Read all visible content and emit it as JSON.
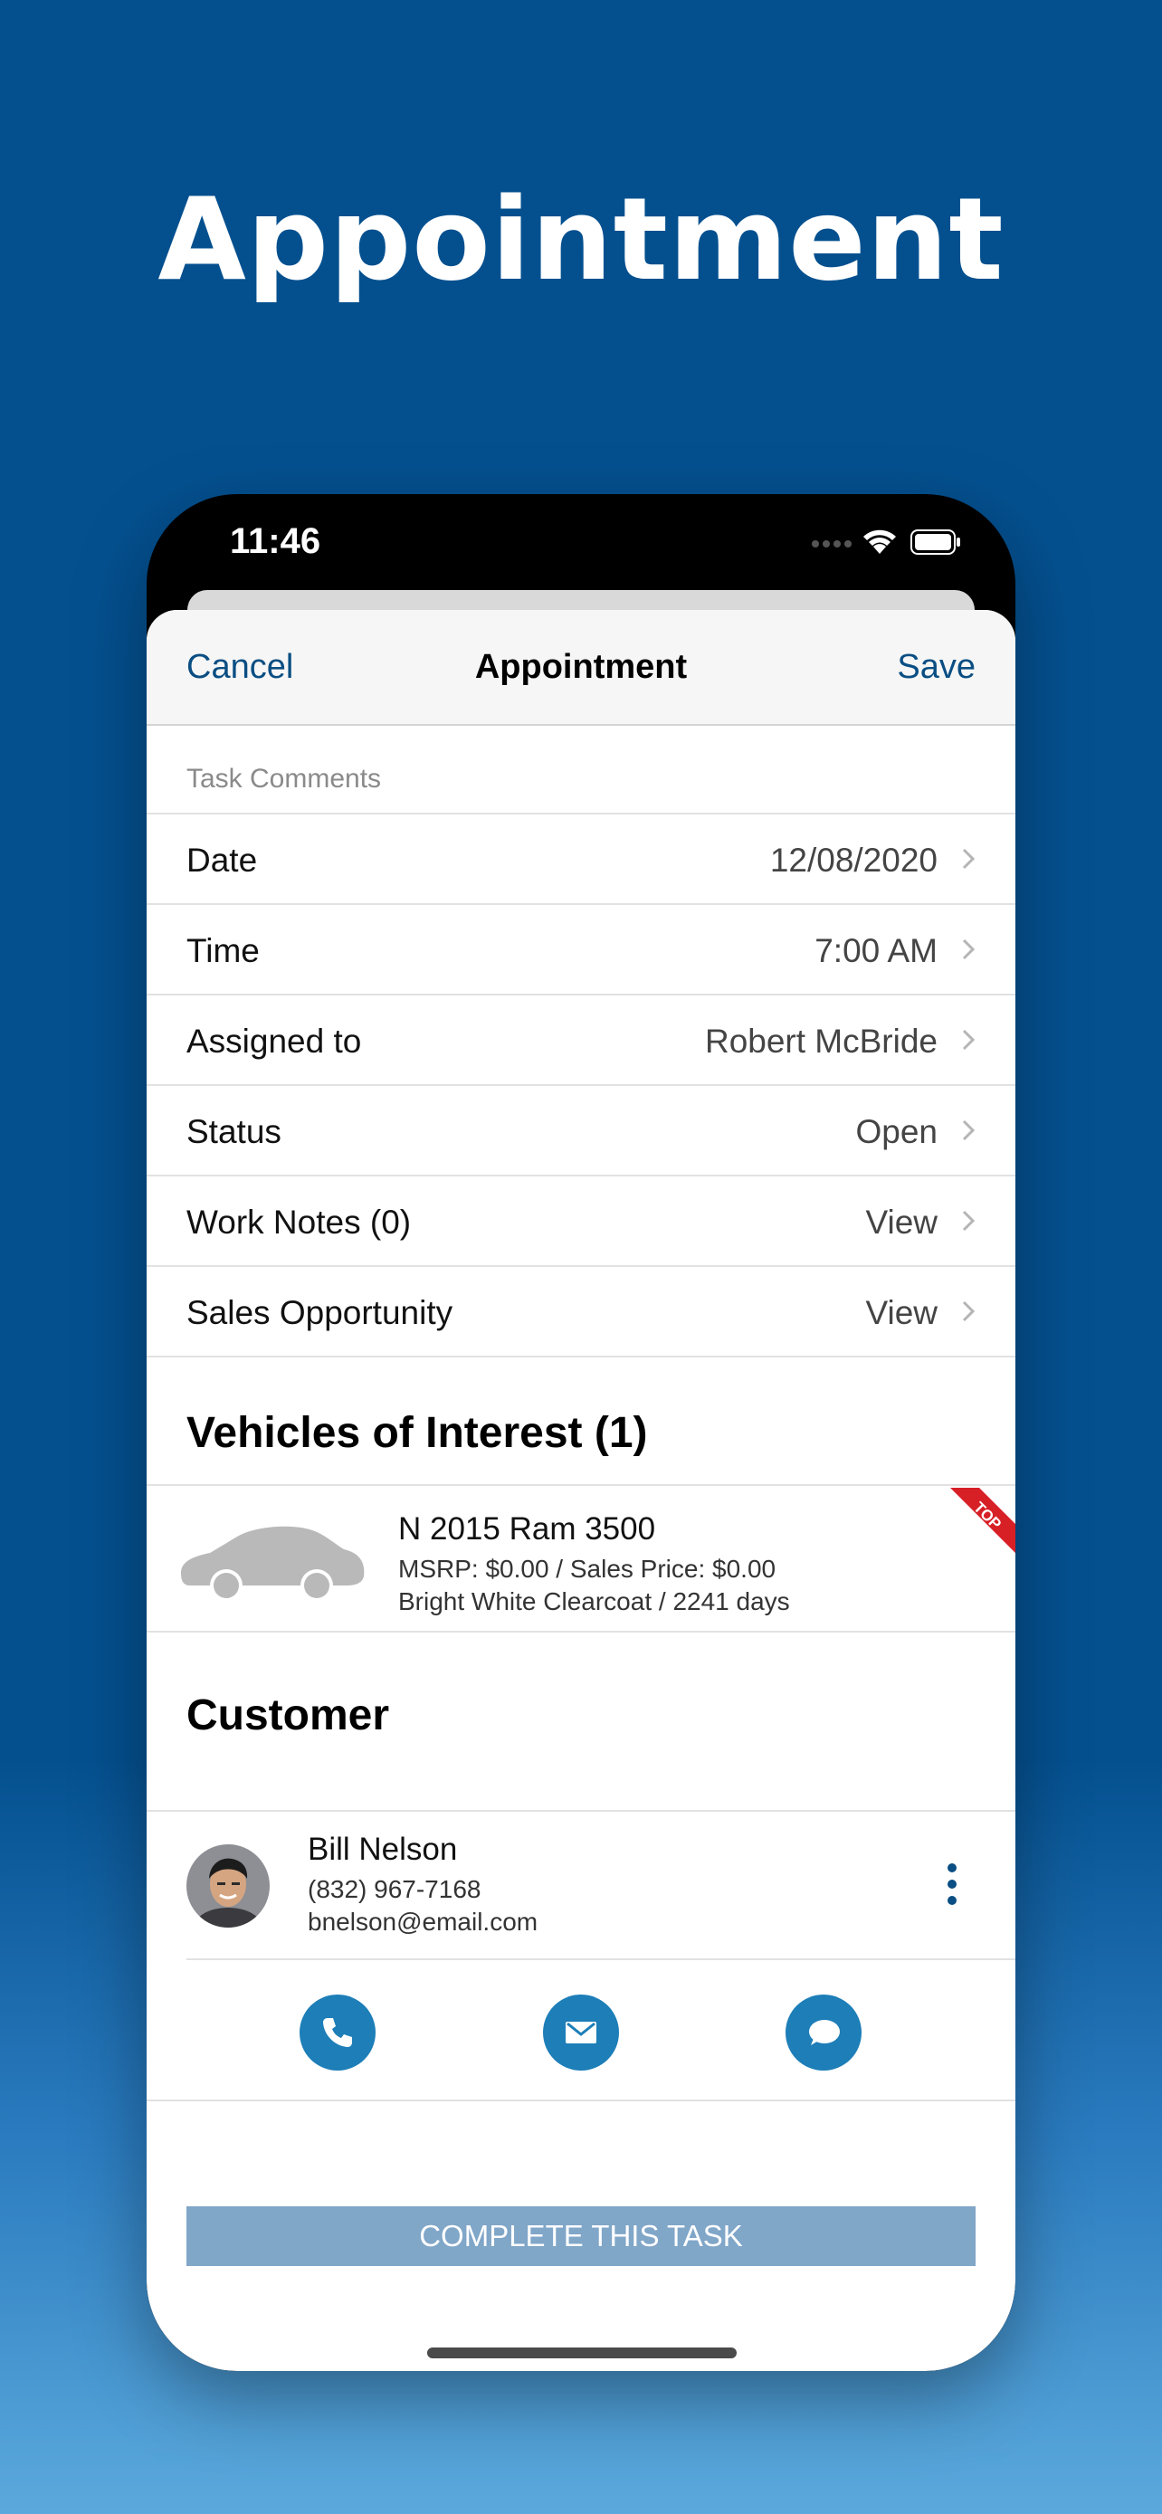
{
  "hero": {
    "title": "Appointment"
  },
  "status_bar": {
    "time": "11:46"
  },
  "nav": {
    "cancel": "Cancel",
    "title": "Appointment",
    "save": "Save"
  },
  "task_comments_label": "Task Comments",
  "rows": [
    {
      "label": "Date",
      "value": "12/08/2020"
    },
    {
      "label": "Time",
      "value": "7:00 AM"
    },
    {
      "label": "Assigned to",
      "value": "Robert McBride"
    },
    {
      "label": "Status",
      "value": "Open"
    },
    {
      "label": "Work Notes (0)",
      "value": "View"
    },
    {
      "label": "Sales Opportunity",
      "value": "View"
    }
  ],
  "vehicles": {
    "title": "Vehicles of Interest (1)",
    "item": {
      "name": "N 2015 Ram 3500",
      "price_line": "MSRP: $0.00 / Sales Price: $0.00",
      "detail_line": "Bright White Clearcoat / 2241 days",
      "badge": "TOP"
    }
  },
  "customer": {
    "title": "Customer",
    "name": "Bill Nelson",
    "phone": "(832) 967-7168",
    "email": "bnelson@email.com"
  },
  "actions": {
    "call_icon": "phone-icon",
    "email_icon": "mail-icon",
    "chat_icon": "chat-icon"
  },
  "complete_button": "COMPLETE THIS TASK",
  "colors": {
    "background": "#04508f",
    "accent": "#0a4e83",
    "action_circle": "#1d7eb8",
    "complete_button": "#80a6c8",
    "ribbon": "#d71f26"
  }
}
